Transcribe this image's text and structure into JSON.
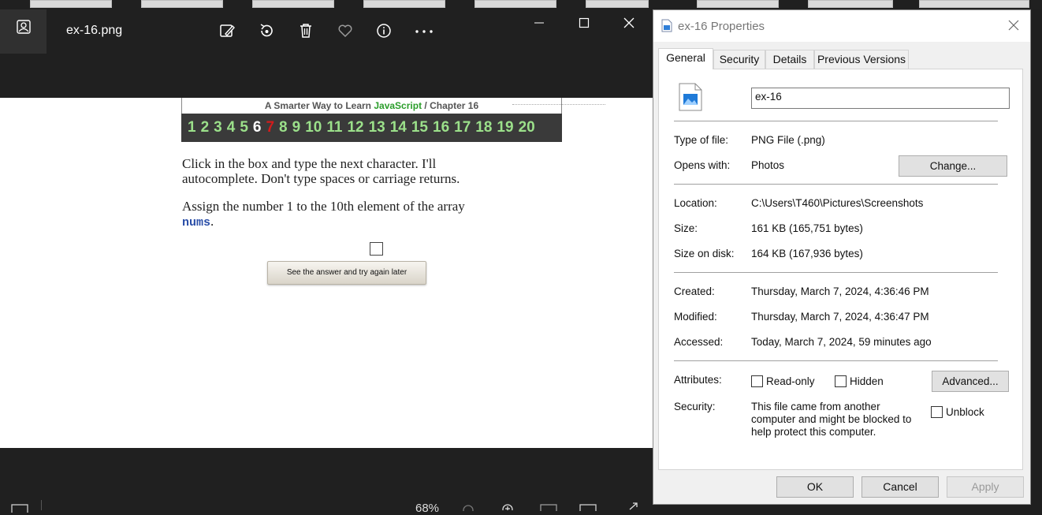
{
  "photos": {
    "filename": "ex-16.png",
    "zoom": "68%",
    "toolbar_icons": [
      "edit-icon",
      "rotate-icon",
      "delete-icon",
      "favorite-icon",
      "info-icon",
      "more-icon"
    ],
    "book": {
      "header_prefix": "A Smarter Way to Learn",
      "header_js": "JavaScript",
      "header_sep": "/",
      "header_chapter": "Chapter 16",
      "numbers": [
        "1",
        "2",
        "3",
        "4",
        "5",
        "6",
        "7",
        "8",
        "9",
        "10",
        "11",
        "12",
        "13",
        "14",
        "15",
        "16",
        "17",
        "18",
        "19",
        "20"
      ],
      "current_number": "6",
      "red_number": "7",
      "instruction_1": "Click in the box and type the next character. I'll autocomplete. Don't type spaces or carriage returns.",
      "instruction_2_prefix": "Assign the number 1 to the 10th element of the array",
      "instruction_2_code": "nums",
      "instruction_2_suffix": ".",
      "answer_button": "See the answer and try again later"
    }
  },
  "props": {
    "title": "ex-16 Properties",
    "tabs": [
      "General",
      "Security",
      "Details",
      "Previous Versions"
    ],
    "name_value": "ex-16",
    "type_label": "Type of file:",
    "type_value": "PNG File (.png)",
    "opens_label": "Opens with:",
    "opens_value": "Photos",
    "change_button": "Change...",
    "location_label": "Location:",
    "location_value": "C:\\Users\\T460\\Pictures\\Screenshots",
    "size_label": "Size:",
    "size_value": "161 KB (165,751 bytes)",
    "sizedisk_label": "Size on disk:",
    "sizedisk_value": "164 KB (167,936 bytes)",
    "created_label": "Created:",
    "created_value": "Thursday, March 7, 2024, 4:36:46 PM",
    "modified_label": "Modified:",
    "modified_value": "Thursday, March 7, 2024, 4:36:47 PM",
    "accessed_label": "Accessed:",
    "accessed_value": "Today, March 7, 2024, 59 minutes ago",
    "attributes_label": "Attributes:",
    "readonly_label": "Read-only",
    "hidden_label": "Hidden",
    "advanced_button": "Advanced...",
    "security_label": "Security:",
    "security_text": "This file came from another computer and might be blocked to help protect this computer.",
    "unblock_label": "Unblock",
    "ok_button": "OK",
    "cancel_button": "Cancel",
    "apply_button": "Apply"
  }
}
